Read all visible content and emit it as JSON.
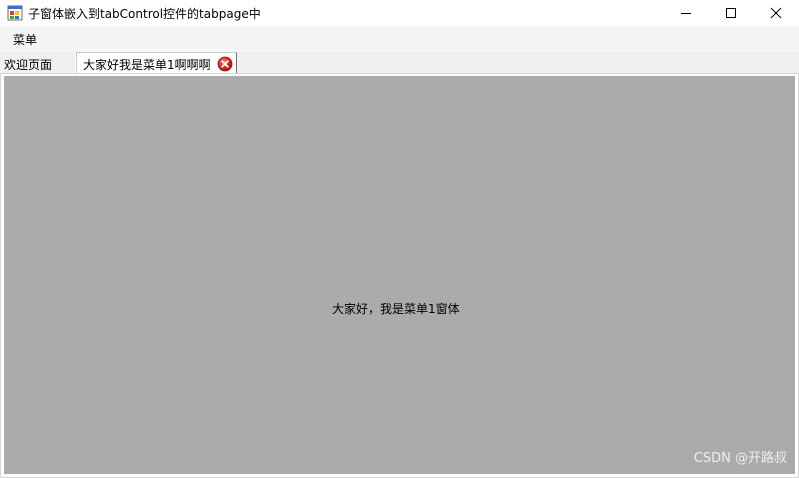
{
  "window": {
    "title": "子窗体嵌入到tabControl控件的tabpage中",
    "icon": "winforms-app-icon"
  },
  "caption_buttons": {
    "minimize": "minimize-icon",
    "maximize": "maximize-icon",
    "close": "close-icon"
  },
  "menubar": {
    "items": [
      {
        "label": "菜单"
      }
    ]
  },
  "tabs": [
    {
      "label": "欢迎页面",
      "selected": false
    },
    {
      "label": "大家好我是菜单1啊啊啊",
      "selected": true,
      "close_icon": "red-x-close-icon"
    }
  ],
  "child_form": {
    "label": "大家好，我是菜单1窗体",
    "background": "#ababab"
  },
  "watermark": "CSDN @开路叔"
}
